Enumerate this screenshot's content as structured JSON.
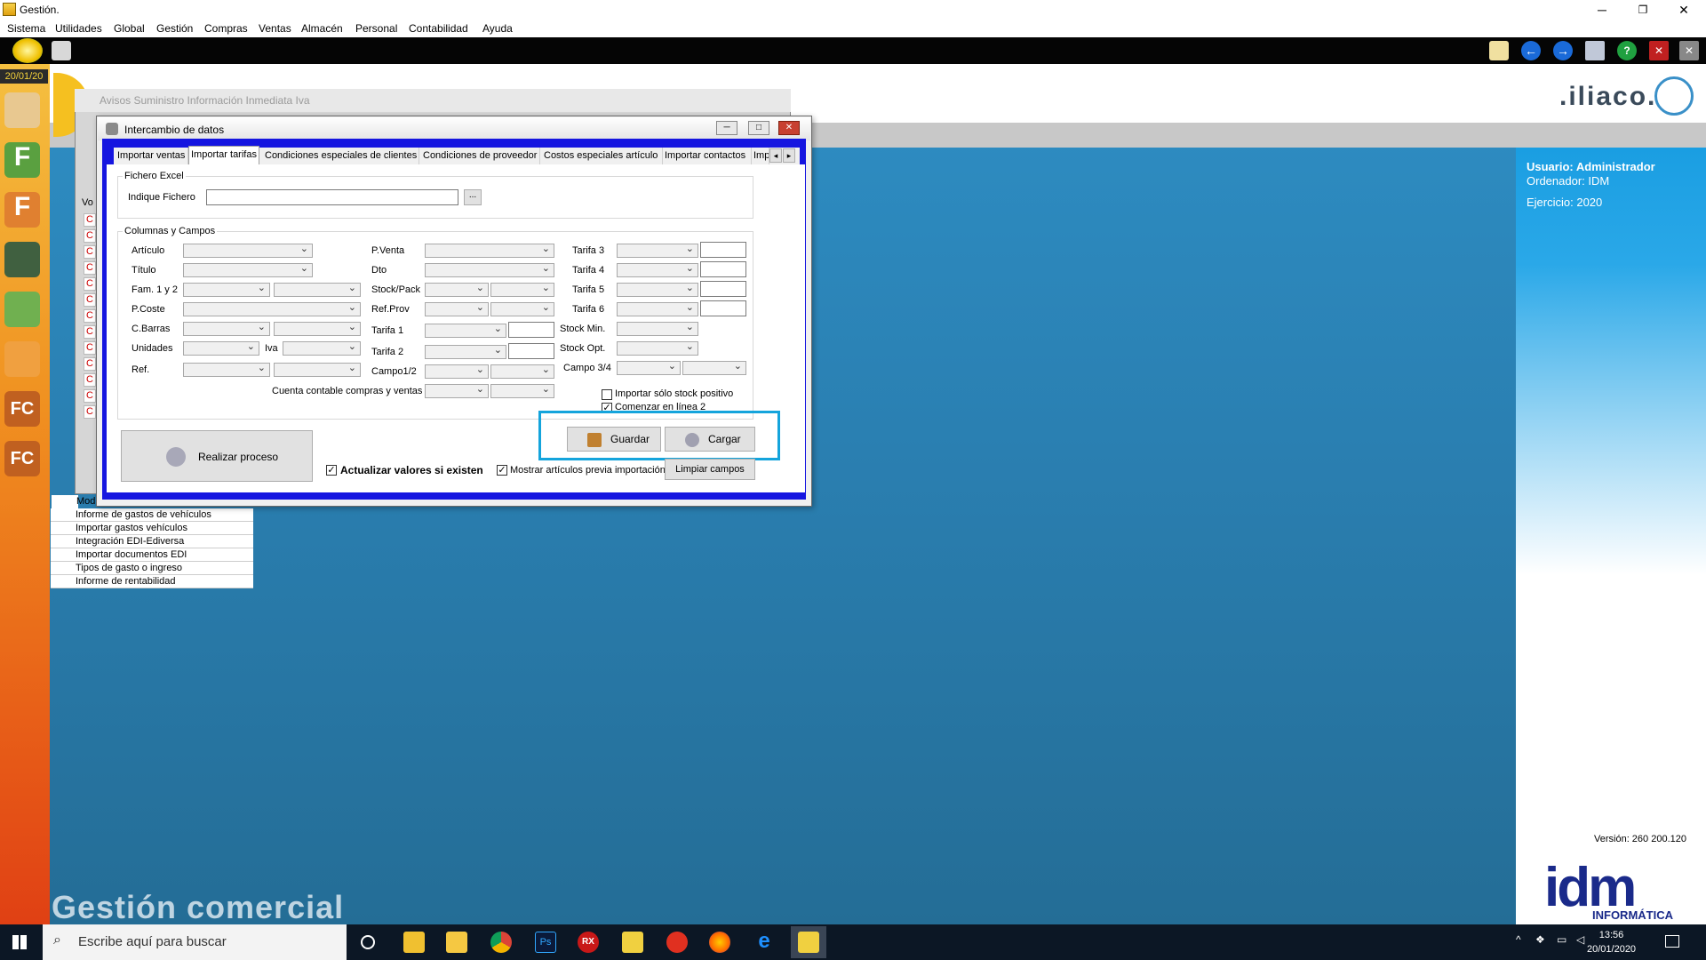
{
  "window": {
    "title": "Gestión."
  },
  "menu": [
    "Sistema",
    "Utilidades",
    "Global",
    "Gestión",
    "Compras",
    "Ventas",
    "Almacén",
    "Personal",
    "Contabilidad",
    "Ayuda"
  ],
  "sidebar": {
    "date": "20/01/20"
  },
  "brand": {
    "logo": ".iliaco.",
    "background_title": "Gestión comercial"
  },
  "user_panel": {
    "usuario": "Usuario: Administrador",
    "ordenador": "Ordenador: IDM",
    "ejercicio": "Ejercicio: 2020",
    "version": "Versión: 260 200.120",
    "idm": "idm",
    "idm_sub": "INFORMÁTICA"
  },
  "bg_window": {
    "title": "Avisos Suministro Información Inmediata Iva",
    "col_header": "Vo",
    "marks": [
      "C",
      "C",
      "C",
      "C",
      "C",
      "C",
      "C",
      "C",
      "C",
      "C",
      "C",
      "C",
      "C"
    ],
    "list_header": "Mod",
    "items": [
      "Informe de gastos de vehículos",
      "Importar gastos vehículos",
      "Integración EDI-Ediversa",
      "Importar documentos EDI",
      "Tipos de gasto o ingreso",
      "Informe de rentabilidad"
    ]
  },
  "dialog": {
    "title": "Intercambio de datos",
    "tabs": [
      "Importar ventas",
      "Importar tarifas",
      "Condiciones especiales de clientes",
      "Condiciones de proveedor",
      "Costos especiales artículo",
      "Importar contactos",
      "Imp"
    ],
    "active_tab": "Importar tarifas",
    "fichero_group": "Fichero Excel",
    "indique_fichero": "Indique Fichero",
    "fichero_value": "",
    "browse": "...",
    "columnas_group": "Columnas y Campos",
    "col1": [
      "Artículo",
      "Título",
      "Fam. 1 y 2",
      "P.Coste",
      "C.Barras",
      "Unidades",
      "Ref."
    ],
    "iva_label": "Iva",
    "col2": [
      "P.Venta",
      "Dto",
      "Stock/Pack",
      "Ref.Prov",
      "Tarifa 1",
      "Tarifa 2",
      "Campo1/2"
    ],
    "cuenta": "Cuenta contable compras y ventas",
    "col3": [
      "Tarifa 3",
      "Tarifa 4",
      "Tarifa 5",
      "Tarifa 6",
      "Stock Min.",
      "Stock Opt.",
      "Campo 3/4"
    ],
    "importar_stock": "Importar sólo stock positivo",
    "importar_stock_checked": false,
    "comenzar": "Comenzar en línea 2",
    "comenzar_checked": true,
    "guardar": "Guardar",
    "cargar": "Cargar",
    "realizar": "Realizar proceso",
    "actualizar": "Actualizar valores si existen",
    "actualizar_checked": true,
    "mostrar": "Mostrar artículos previa importación",
    "mostrar_checked": true,
    "limpiar": "Limpiar campos"
  },
  "taskbar": {
    "search_placeholder": "Escribe aquí para buscar",
    "time": "13:56",
    "date": "20/01/2020"
  },
  "colors": {
    "accent": "#14a4dc",
    "dialog_frame": "#1515e0",
    "desktop": "#2a7fb1"
  }
}
